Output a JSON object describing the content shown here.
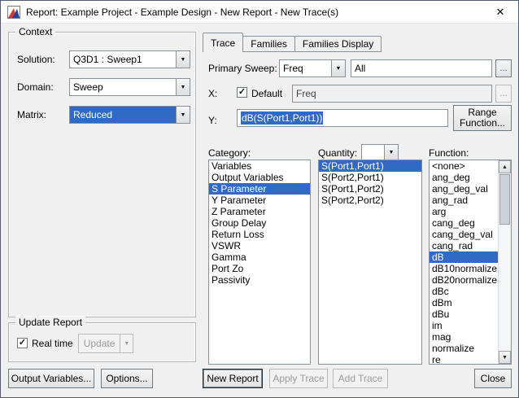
{
  "colors": {
    "selection": "#316ac5"
  },
  "glyphs": {
    "close": "✕",
    "dropdown": "▼",
    "check": "✓",
    "scroll_up": "▲",
    "scroll_down": "▼"
  },
  "window": {
    "title": "Report: Example Project - Example Design - New Report - New Trace(s)"
  },
  "context": {
    "title": "Context",
    "solution_label": "Solution:",
    "solution_value": "Q3D1 : Sweep1",
    "domain_label": "Domain:",
    "domain_value": "Sweep",
    "matrix_label": "Matrix:",
    "matrix_value": "Reduced"
  },
  "update_report": {
    "title": "Update Report",
    "real_time": "Real time",
    "update": "Update"
  },
  "footer_left": {
    "output_variables": "Output Variables...",
    "options": "Options..."
  },
  "tabs": {
    "trace": "Trace",
    "families": "Families",
    "families_display": "Families Display"
  },
  "trace": {
    "primary_sweep_label": "Primary Sweep:",
    "primary_sweep_value": "Freq",
    "sweep_range_value": "All",
    "ellipsis": "...",
    "x_label": "X:",
    "default_label": "Default",
    "x_value": "Freq",
    "y_label": "Y:",
    "y_value": "dB(S(Port1,Port1))",
    "range_function": "Range Function...",
    "category_label": "Category:",
    "categories": [
      "Variables",
      "Output Variables",
      "S Parameter",
      "Y Parameter",
      "Z Parameter",
      "Group Delay",
      "Return Loss",
      "VSWR",
      "Gamma",
      "Port Zo",
      "Passivity"
    ],
    "category_selected": "S Parameter",
    "quantity_label": "Quantity:",
    "quantity_combo_value": "",
    "quantities": [
      "S(Port1,Port1)",
      "S(Port2,Port1)",
      "S(Port1,Port2)",
      "S(Port2,Port2)"
    ],
    "quantity_selected": "S(Port1,Port1)",
    "function_label": "Function:",
    "functions": [
      "<none>",
      "ang_deg",
      "ang_deg_val",
      "ang_rad",
      "arg",
      "cang_deg",
      "cang_deg_val",
      "cang_rad",
      "dB",
      "dB10normalize",
      "dB20normalize",
      "dBc",
      "dBm",
      "dBu",
      "im",
      "mag",
      "normalize",
      "re"
    ],
    "function_selected": "dB"
  },
  "footer_right": {
    "new_report": "New Report",
    "apply_trace": "Apply Trace",
    "add_trace": "Add Trace",
    "close": "Close"
  }
}
